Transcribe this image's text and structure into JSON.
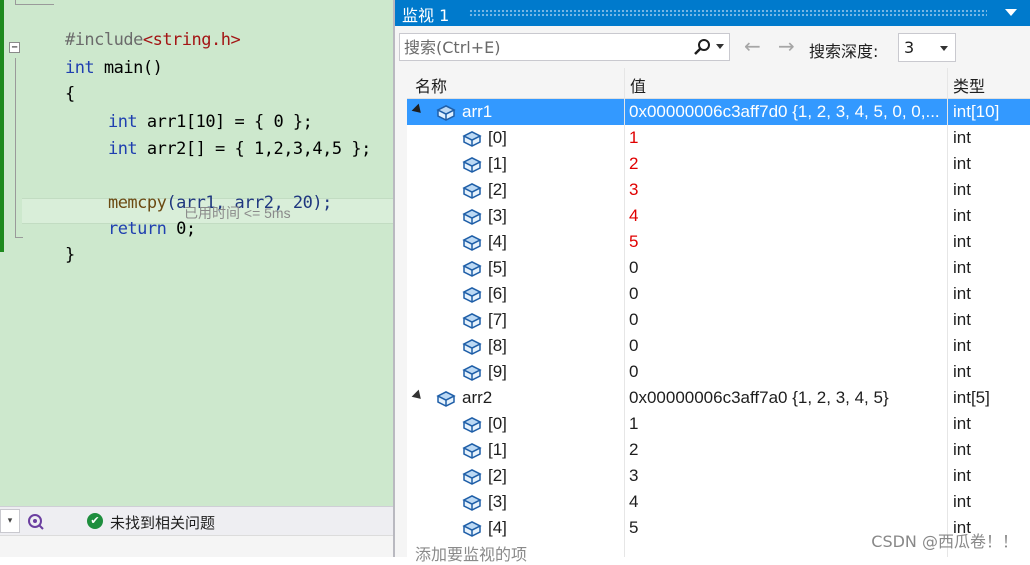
{
  "editor": {
    "code": {
      "include_kw": "#include",
      "include_file": "<string.h>",
      "int1": "int",
      "main": " main()",
      "open_brace": "{",
      "line_arr1_kw": "int",
      "line_arr1_rest": " arr1[10] = { 0 };",
      "line_arr2_kw": "int",
      "line_arr2_rest": " arr2[] = { 1,2,3,4,5 };",
      "memcpy_fn": "memcpy",
      "memcpy_rest": "(arr1, arr2, 20);",
      "return_kw": "return",
      "return_rest": " 0;",
      "close_brace": "}",
      "perf_hint": "已用时间 <= 5ms",
      "fold_glyph": "−"
    },
    "status": {
      "issues_text": "未找到相关问题",
      "dropdown_glyph": "▾",
      "ok_glyph": "✔"
    }
  },
  "watch": {
    "title": "监视 1",
    "search_placeholder": "搜索(Ctrl+E)",
    "back_glyph": "←",
    "forward_glyph": "→",
    "depth_label": "搜索深度:",
    "depth_value": "3",
    "columns": {
      "name": "名称",
      "value": "值",
      "type": "类型"
    },
    "rows": [
      {
        "name": "arr1",
        "value": "0x00000006c3aff7d0 {1, 2, 3, 4, 5, 0, 0,...",
        "type": "int[10]",
        "level": 0,
        "selected": true,
        "changed": false
      },
      {
        "name": "[0]",
        "value": "1",
        "type": "int",
        "level": 1,
        "changed": true
      },
      {
        "name": "[1]",
        "value": "2",
        "type": "int",
        "level": 1,
        "changed": true
      },
      {
        "name": "[2]",
        "value": "3",
        "type": "int",
        "level": 1,
        "changed": true
      },
      {
        "name": "[3]",
        "value": "4",
        "type": "int",
        "level": 1,
        "changed": true
      },
      {
        "name": "[4]",
        "value": "5",
        "type": "int",
        "level": 1,
        "changed": true
      },
      {
        "name": "[5]",
        "value": "0",
        "type": "int",
        "level": 1,
        "changed": false
      },
      {
        "name": "[6]",
        "value": "0",
        "type": "int",
        "level": 1,
        "changed": false
      },
      {
        "name": "[7]",
        "value": "0",
        "type": "int",
        "level": 1,
        "changed": false
      },
      {
        "name": "[8]",
        "value": "0",
        "type": "int",
        "level": 1,
        "changed": false
      },
      {
        "name": "[9]",
        "value": "0",
        "type": "int",
        "level": 1,
        "changed": false
      },
      {
        "name": "arr2",
        "value": "0x00000006c3aff7a0 {1, 2, 3, 4, 5}",
        "type": "int[5]",
        "level": 0,
        "selected": false,
        "changed": false
      },
      {
        "name": "[0]",
        "value": "1",
        "type": "int",
        "level": 1,
        "changed": false
      },
      {
        "name": "[1]",
        "value": "2",
        "type": "int",
        "level": 1,
        "changed": false
      },
      {
        "name": "[2]",
        "value": "3",
        "type": "int",
        "level": 1,
        "changed": false
      },
      {
        "name": "[3]",
        "value": "4",
        "type": "int",
        "level": 1,
        "changed": false
      },
      {
        "name": "[4]",
        "value": "5",
        "type": "int",
        "level": 1,
        "changed": false
      }
    ],
    "add_item_hint": "添加要监视的项",
    "watermark": "CSDN @西瓜卷！！"
  },
  "colors": {
    "accent": "#007acc",
    "selection": "#3399ff",
    "changed_value": "#e00000",
    "editor_bg": "#cde8cd"
  }
}
